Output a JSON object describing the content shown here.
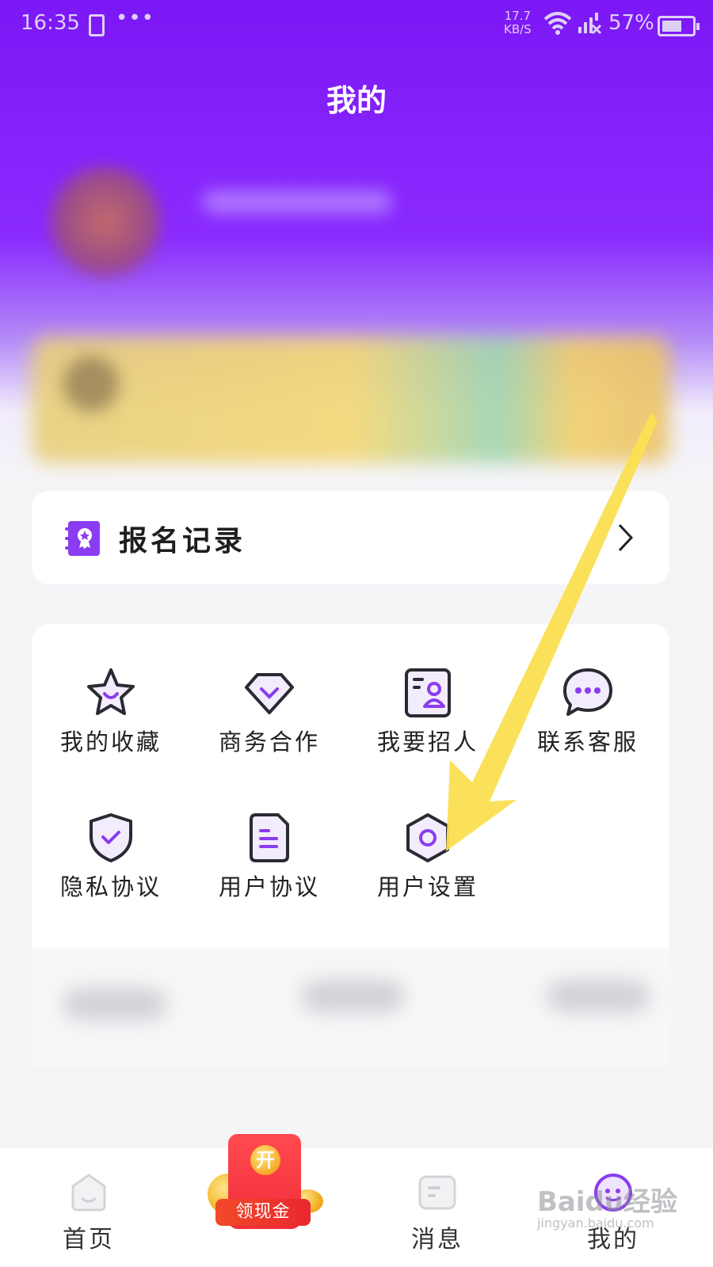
{
  "status_bar": {
    "time": "16:35",
    "dots": "•••",
    "speed_value": "17.7",
    "speed_unit": "KB/S",
    "battery_percent": "57%"
  },
  "header": {
    "title": "我的"
  },
  "record": {
    "label": "报名记录",
    "icon": "certificate-book-icon"
  },
  "menu": {
    "items": [
      {
        "label": "我的收藏",
        "icon": "star-icon"
      },
      {
        "label": "商务合作",
        "icon": "diamond-icon"
      },
      {
        "label": "我要招人",
        "icon": "id-card-icon"
      },
      {
        "label": "联系客服",
        "icon": "chat-bubble-icon"
      },
      {
        "label": "隐私协议",
        "icon": "shield-check-icon"
      },
      {
        "label": "用户协议",
        "icon": "document-icon"
      },
      {
        "label": "用户设置",
        "icon": "settings-hexagon-icon"
      }
    ]
  },
  "tabbar": {
    "tabs": [
      {
        "label": "首页",
        "icon": "home-icon"
      },
      {
        "label": "消息",
        "icon": "message-icon"
      },
      {
        "label": "我的",
        "icon": "profile-face-icon"
      }
    ],
    "cash": {
      "open": "开",
      "label": "领现金"
    }
  },
  "watermark": {
    "text": "Baidu经验",
    "sub": "jingyan.baidu.com"
  },
  "colors": {
    "brand_purple": "#7c17f5",
    "icon_purple": "#8a3cf0",
    "arrow_yellow": "#fbe052",
    "cash_red": "#f22d3a"
  }
}
